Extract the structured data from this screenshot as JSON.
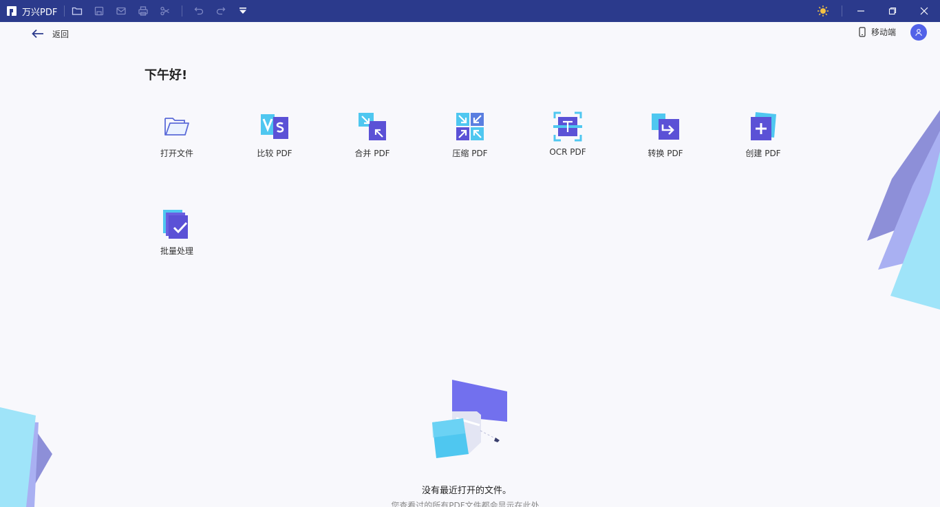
{
  "titlebar": {
    "app_title": "万兴PDF",
    "icons": [
      "open-folder-icon",
      "save-icon",
      "mail-icon",
      "print-icon",
      "scissors-icon",
      "undo-icon",
      "redo-icon",
      "dropdown-icon"
    ],
    "right_icons": [
      "theme-sun-icon",
      "minimize-icon",
      "maximize-icon",
      "close-icon"
    ],
    "background": "#2b3a8c"
  },
  "header": {
    "back_label": "返回",
    "mobile_label": "移动端"
  },
  "greeting": "下午好!",
  "tools": [
    {
      "label": "打开文件",
      "icon": "open-file-icon"
    },
    {
      "label": "比较 PDF",
      "icon": "compare-pdf-icon"
    },
    {
      "label": "合并 PDF",
      "icon": "merge-pdf-icon"
    },
    {
      "label": "压缩 PDF",
      "icon": "compress-pdf-icon"
    },
    {
      "label": "OCR PDF",
      "icon": "ocr-pdf-icon"
    },
    {
      "label": "转换 PDF",
      "icon": "convert-pdf-icon"
    },
    {
      "label": "创建 PDF",
      "icon": "create-pdf-icon"
    },
    {
      "label": "批量处理",
      "icon": "batch-process-icon"
    }
  ],
  "empty_state": {
    "title": "没有最近打开的文件。",
    "subtitle": "您查看过的所有PDF文件都会显示在此处"
  },
  "colors": {
    "accent": "#5262e8",
    "purple": "#6a5fe0",
    "cyan": "#5ad2f4"
  }
}
